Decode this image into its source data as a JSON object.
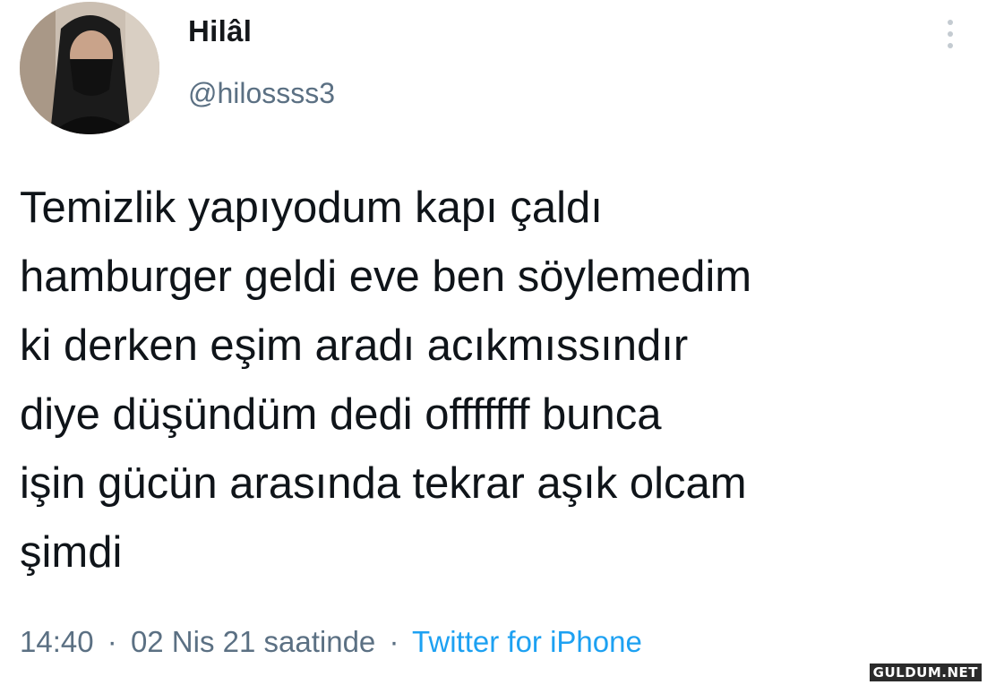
{
  "tweet": {
    "display_name": "Hilâl",
    "handle": "@hilossss3",
    "text": "Temizlik yapıyodum kapı çaldı\nhamburger geldi eve ben söylemedim\nki derken eşim aradı acıkmıssındır\ndiye düşündüm dedi offfffff bunca\nişin gücün arasında tekrar aşık olcam\nşimdi",
    "time": "14:40",
    "date": "02 Nis 21 saatinde",
    "separator": "·",
    "source": "Twitter for iPhone",
    "more_icon": "vertical-dots-icon"
  },
  "watermark": "GULDUM.NET",
  "colors": {
    "text": "#0f1419",
    "secondary": "#5b7083",
    "link": "#1da1f2"
  }
}
